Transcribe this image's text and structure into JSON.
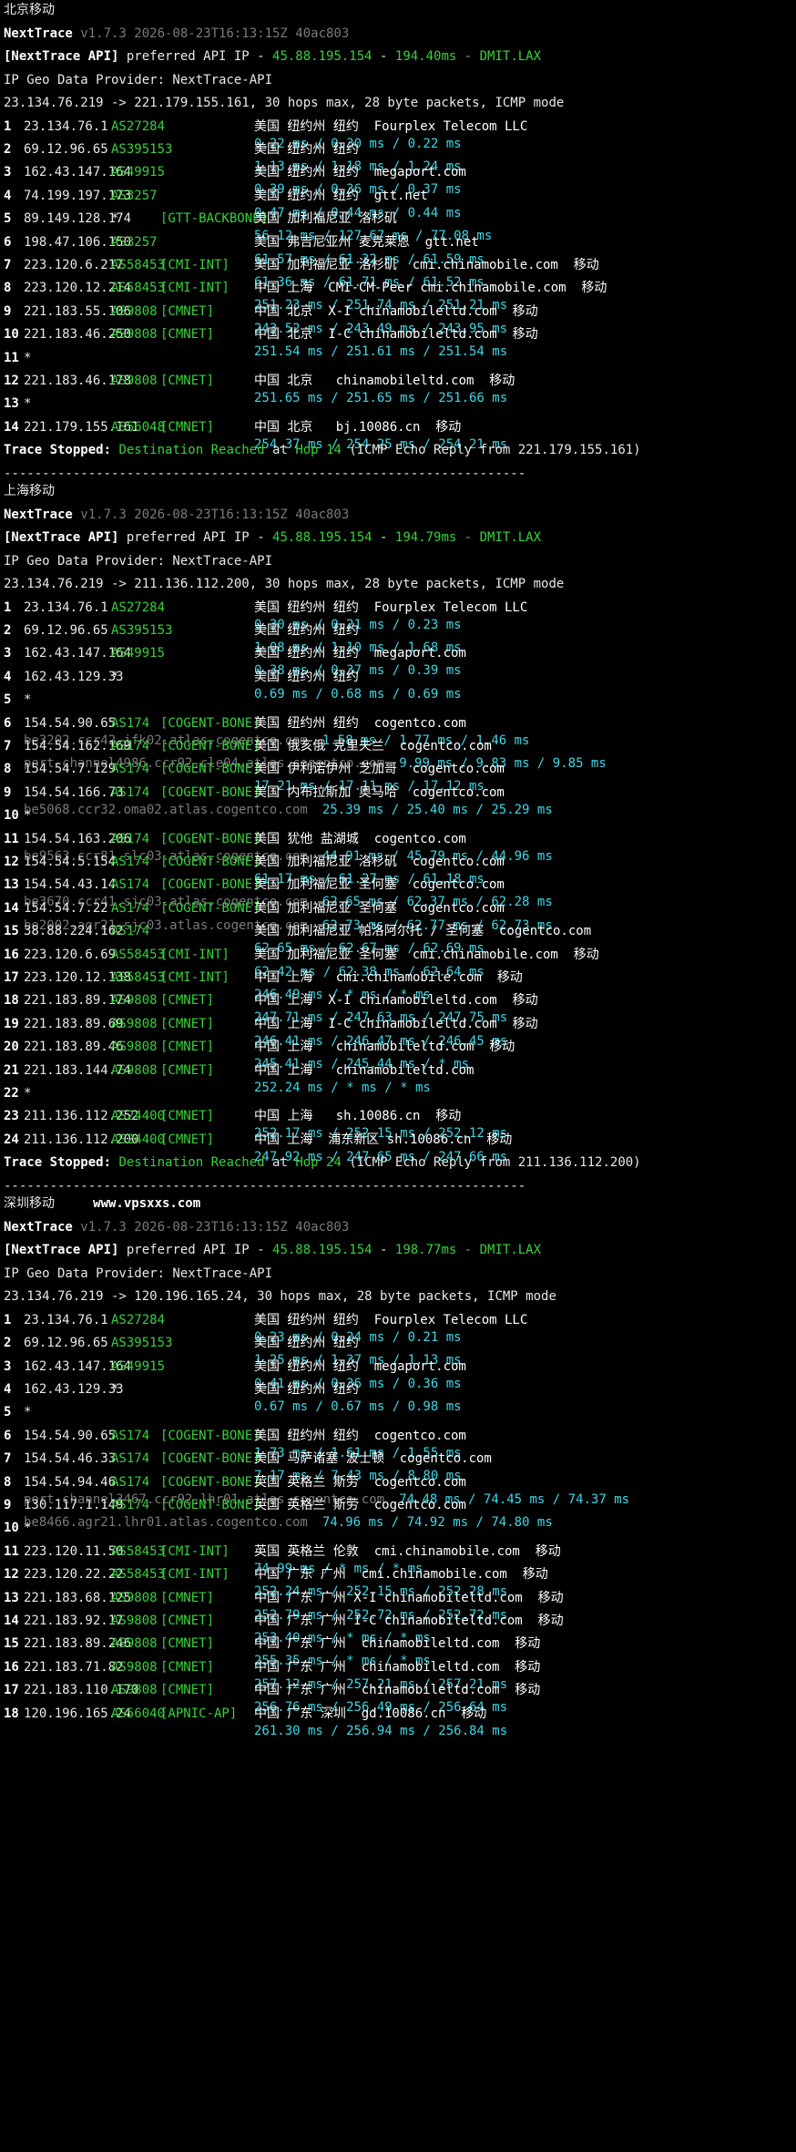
{
  "colors": {
    "text": "#e8e8e8",
    "dim": "#7a7a7a",
    "green": "#38d13a",
    "yellow": "#e5d43a",
    "cyan": "#3fd7e6",
    "bg": "#000000"
  },
  "sections": [
    {
      "title": "北京移动",
      "title_extra": "",
      "tool": "NextTrace",
      "version": "v1.7.3 2026-08-23T16:13:15Z 40ac803",
      "api_prefix": "[NextTrace API]",
      "api_mid": " preferred API IP - ",
      "api_ip": "45.88.195.154",
      "api_sep": " - ",
      "api_latency": "194.40ms",
      "api_site": " - DMIT.LAX",
      "geo_provider": "IP Geo Data Provider: NextTrace-API",
      "trace_info": "23.134.76.219 -> 221.179.155.161, 30 hops max, 28 byte packets, ICMP mode",
      "hops": [
        {
          "n": "1",
          "ip": "23.134.76.1",
          "asn": "AS27284",
          "tag": "",
          "geo": "美国 纽约州 纽约  Fourplex Telecom LLC",
          "rdns": "",
          "rtt": "0.22 ms / 0.30 ms / 0.22 ms"
        },
        {
          "n": "2",
          "ip": "69.12.96.65",
          "asn": "AS395153",
          "tag": "",
          "geo": "美国 纽约州 纽约",
          "rdns": "",
          "rtt": "1.13 ms / 1.18 ms / 1.24 ms"
        },
        {
          "n": "3",
          "ip": "162.43.147.164",
          "asn": "AS49915",
          "tag": "",
          "geo": "美国 纽约州 纽约  megaport.com",
          "rdns": "",
          "rtt": "0.39 ms / 0.36 ms / 0.37 ms"
        },
        {
          "n": "4",
          "ip": "74.199.197.173",
          "asn": "AS3257",
          "tag": "",
          "geo": "美国 纽约州 纽约  gtt.net",
          "rdns": "",
          "rtt": "0.47 ms / 0.44 ms / 0.44 ms"
        },
        {
          "n": "5",
          "ip": "89.149.128.174",
          "asn": "*",
          "tag": "[GTT-BACKBONE]",
          "geo": "美国 加利福尼亚 洛杉矶",
          "rdns": "",
          "rtt": "56.12 ms / 127.67 ms / 77.08 ms"
        },
        {
          "n": "6",
          "ip": "198.47.106.150",
          "asn": "AS3257",
          "tag": "",
          "geo": "美国 弗吉尼亚州 麦克莱恩  gtt.net",
          "rdns": "",
          "rtt": "61.57 ms / 61.32 ms / 61.59 ms"
        },
        {
          "n": "7",
          "ip": "223.120.6.217",
          "asn": "AS58453",
          "tag": "[CMI-INT]",
          "geo": "美国 加利福尼亚 洛杉矶  cmi.chinamobile.com  移动",
          "rdns": "",
          "rtt": "61.36 ms / 61.71 ms / 61.52 ms"
        },
        {
          "n": "8",
          "ip": "223.120.12.214",
          "asn": "AS58453",
          "tag": "[CMI-INT]",
          "geo": "中国 上海  CMI-CM-Peer cmi.chinamobile.com  移动",
          "rdns": "",
          "rtt": "251.23 ms / 251.74 ms / 251.21 ms"
        },
        {
          "n": "9",
          "ip": "221.183.55.106",
          "asn": "AS9808",
          "tag": "[CMNET]",
          "geo": "中国 北京  X-I chinamobileltd.com  移动",
          "rdns": "",
          "rtt": "243.52 ms / 243.49 ms / 243.95 ms"
        },
        {
          "n": "10",
          "ip": "221.183.46.250",
          "asn": "AS9808",
          "tag": "[CMNET]",
          "geo": "中国 北京  I-C chinamobileltd.com  移动",
          "rdns": "",
          "rtt": "251.54 ms / 251.61 ms / 251.54 ms"
        },
        {
          "n": "11",
          "ip": "*",
          "asn": "",
          "tag": "",
          "geo": "",
          "rdns": "",
          "rtt": ""
        },
        {
          "n": "12",
          "ip": "221.183.46.178",
          "asn": "AS9808",
          "tag": "[CMNET]",
          "geo": "中国 北京   chinamobileltd.com  移动",
          "rdns": "",
          "rtt": "251.65 ms / 251.65 ms / 251.66 ms"
        },
        {
          "n": "13",
          "ip": "*",
          "asn": "",
          "tag": "",
          "geo": "",
          "rdns": "",
          "rtt": ""
        },
        {
          "n": "14",
          "ip": "221.179.155.161",
          "asn": "AS56048",
          "tag": "[CMNET]",
          "geo": "中国 北京   bj.10086.cn  移动",
          "rdns": "",
          "rtt": "254.37 ms / 254.25 ms / 254.21 ms"
        }
      ],
      "stop_prefix": "Trace Stopped: ",
      "stop_reached": "Destination Reached",
      "stop_at": " at ",
      "stop_hop": "Hop 14",
      "stop_suffix": " (ICMP Echo Reply from 221.179.155.161)",
      "separator": "--------------------------------------------------------------------"
    },
    {
      "title": "上海移动",
      "title_extra": "",
      "tool": "NextTrace",
      "version": "v1.7.3 2026-08-23T16:13:15Z 40ac803",
      "api_prefix": "[NextTrace API]",
      "api_mid": " preferred API IP - ",
      "api_ip": "45.88.195.154",
      "api_sep": " - ",
      "api_latency": "194.79ms",
      "api_site": " - DMIT.LAX",
      "geo_provider": "IP Geo Data Provider: NextTrace-API",
      "trace_info": "23.134.76.219 -> 211.136.112.200, 30 hops max, 28 byte packets, ICMP mode",
      "hops": [
        {
          "n": "1",
          "ip": "23.134.76.1",
          "asn": "AS27284",
          "tag": "",
          "geo": "美国 纽约州 纽约  Fourplex Telecom LLC",
          "rdns": "",
          "rtt": "0.30 ms / 0.21 ms / 0.23 ms"
        },
        {
          "n": "2",
          "ip": "69.12.96.65",
          "asn": "AS395153",
          "tag": "",
          "geo": "美国 纽约州 纽约",
          "rdns": "",
          "rtt": "1.08 ms / 1.10 ms / 1.68 ms"
        },
        {
          "n": "3",
          "ip": "162.43.147.164",
          "asn": "AS49915",
          "tag": "",
          "geo": "美国 纽约州 纽约  megaport.com",
          "rdns": "",
          "rtt": "0.38 ms / 0.37 ms / 0.39 ms"
        },
        {
          "n": "4",
          "ip": "162.43.129.33",
          "asn": "*",
          "tag": "",
          "geo": "美国 纽约州 纽约",
          "rdns": "",
          "rtt": "0.69 ms / 0.68 ms / 0.69 ms"
        },
        {
          "n": "5",
          "ip": "*",
          "asn": "",
          "tag": "",
          "geo": "",
          "rdns": "",
          "rtt": ""
        },
        {
          "n": "6",
          "ip": "154.54.90.65",
          "asn": "AS174",
          "tag": "[COGENT-BONE]",
          "geo": "美国 纽约州 纽约  cogentco.com",
          "rdns": "be3202.ccr42.jfk02.atlas.cogentco.com",
          "rtt": "1.58 ms / 1.77 ms / 1.46 ms"
        },
        {
          "n": "7",
          "ip": "154.54.162.169",
          "asn": "AS174",
          "tag": "[COGENT-BONE]",
          "geo": "美国 俄亥俄 克里夫兰  cogentco.com",
          "rdns": "port-channel4986.ccr92.cle04.atlas.cogentco.com",
          "rtt": "9.99 ms / 9.83 ms / 9.85 ms"
        },
        {
          "n": "8",
          "ip": "154.54.7.129",
          "asn": "AS174",
          "tag": "[COGENT-BONE]",
          "geo": "美国 伊利诺伊州 芝加哥  cogentco.com",
          "rdns": "",
          "rtt": "17.21 ms / 17.11 ms / 17.12 ms"
        },
        {
          "n": "9",
          "ip": "154.54.166.73",
          "asn": "AS174",
          "tag": "[COGENT-BONE]",
          "geo": "美国 内布拉斯加 奥马哈  cogentco.com",
          "rdns": "be5068.ccr32.oma02.atlas.cogentco.com",
          "rtt": "25.39 ms / 25.40 ms / 25.29 ms"
        },
        {
          "n": "10",
          "ip": "*",
          "asn": "",
          "tag": "",
          "geo": "",
          "rdns": "",
          "rtt": ""
        },
        {
          "n": "11",
          "ip": "154.54.163.206",
          "asn": "AS174",
          "tag": "[COGENT-BONE]",
          "geo": "美国 犹他 盐湖城  cogentco.com",
          "rdns": "be9563.ccr81.slc03.atlas.cogentco.com",
          "rtt": "44.91 ms / 45.79 ms / 44.96 ms"
        },
        {
          "n": "12",
          "ip": "154.54.5.154",
          "asn": "AS174",
          "tag": "[COGENT-BONE]",
          "geo": "美国 加利福尼亚 洛杉矶  cogentco.com",
          "rdns": "",
          "rtt": "61.17 ms / 61.27 ms / 61.18 ms"
        },
        {
          "n": "13",
          "ip": "154.54.43.14",
          "asn": "AS174",
          "tag": "[COGENT-BONE]",
          "geo": "美国 加利福尼亚 圣何塞  cogentco.com",
          "rdns": "be3670.ccr41.sjc03.atlas.cogentco.com",
          "rtt": "62.65 ms / 62.37 ms / 62.28 ms"
        },
        {
          "n": "14",
          "ip": "154.54.7.22",
          "asn": "AS174",
          "tag": "[COGENT-BONE]",
          "geo": "美国 加利福尼亚 圣何塞  cogentco.com",
          "rdns": "be2002.agr21.sjc03.atlas.cogentco.com",
          "rtt": "62.73 ms / 62.77 ms / 62.73 ms"
        },
        {
          "n": "15",
          "ip": "38.88.224.162",
          "asn": "AS174",
          "tag": "",
          "geo": "美国 加利福尼亚 帕洛阿尔托 / 圣何塞  cogentco.com",
          "rdns": "",
          "rtt": "62.65 ms / 62.67 ms / 62.69 ms"
        },
        {
          "n": "16",
          "ip": "223.120.6.69",
          "asn": "AS58453",
          "tag": "[CMI-INT]",
          "geo": "美国 加利福尼亚 圣何塞  cmi.chinamobile.com  移动",
          "rdns": "",
          "rtt": "62.42 ms / 62.38 ms / 62.64 ms"
        },
        {
          "n": "17",
          "ip": "223.120.12.138",
          "asn": "AS58453",
          "tag": "[CMI-INT]",
          "geo": "中国 上海   cmi.chinamobile.com  移动",
          "rdns": "",
          "rtt": "246.49 ms / * ms / * ms"
        },
        {
          "n": "18",
          "ip": "221.183.89.174",
          "asn": "AS9808",
          "tag": "[CMNET]",
          "geo": "中国 上海  X-I chinamobileltd.com  移动",
          "rdns": "",
          "rtt": "247.71 ms / 247.63 ms / 247.75 ms"
        },
        {
          "n": "19",
          "ip": "221.183.89.69",
          "asn": "AS9808",
          "tag": "[CMNET]",
          "geo": "中国 上海  I-C chinamobileltd.com  移动",
          "rdns": "",
          "rtt": "246.41 ms / 246.47 ms / 246.45 ms"
        },
        {
          "n": "20",
          "ip": "221.183.89.46",
          "asn": "AS9808",
          "tag": "[CMNET]",
          "geo": "中国 上海   chinamobileltd.com  移动",
          "rdns": "",
          "rtt": "245.41 ms / 245.44 ms / * ms"
        },
        {
          "n": "21",
          "ip": "221.183.144.74",
          "asn": "AS9808",
          "tag": "[CMNET]",
          "geo": "中国 上海   chinamobileltd.com",
          "rdns": "",
          "rtt": "252.24 ms / * ms / * ms"
        },
        {
          "n": "22",
          "ip": "*",
          "asn": "",
          "tag": "",
          "geo": "",
          "rdns": "",
          "rtt": ""
        },
        {
          "n": "23",
          "ip": "211.136.112.252",
          "asn": "AS24400",
          "tag": "[CMNET]",
          "geo": "中国 上海   sh.10086.cn  移动",
          "rdns": "",
          "rtt": "252.17 ms / 252.15 ms / 252.12 ms"
        },
        {
          "n": "24",
          "ip": "211.136.112.200",
          "asn": "AS24400",
          "tag": "[CMNET]",
          "geo": "中国 上海  浦东新区 sh.10086.cn  移动",
          "rdns": "",
          "rtt": "247.92 ms / 247.65 ms / 247.66 ms"
        }
      ],
      "stop_prefix": "Trace Stopped: ",
      "stop_reached": "Destination Reached",
      "stop_at": " at ",
      "stop_hop": "Hop 24",
      "stop_suffix": " (ICMP Echo Reply from 211.136.112.200)",
      "separator": "--------------------------------------------------------------------"
    },
    {
      "title": "深圳移动",
      "title_extra": "www.vpsxxs.com",
      "tool": "NextTrace",
      "version": "v1.7.3 2026-08-23T16:13:15Z 40ac803",
      "api_prefix": "[NextTrace API]",
      "api_mid": " preferred API IP - ",
      "api_ip": "45.88.195.154",
      "api_sep": " - ",
      "api_latency": "198.77ms",
      "api_site": " - DMIT.LAX",
      "geo_provider": "IP Geo Data Provider: NextTrace-API",
      "trace_info": "23.134.76.219 -> 120.196.165.24, 30 hops max, 28 byte packets, ICMP mode",
      "hops": [
        {
          "n": "1",
          "ip": "23.134.76.1",
          "asn": "AS27284",
          "tag": "",
          "geo": "美国 纽约州 纽约  Fourplex Telecom LLC",
          "rdns": "",
          "rtt": "0.23 ms / 0.24 ms / 0.21 ms"
        },
        {
          "n": "2",
          "ip": "69.12.96.65",
          "asn": "AS395153",
          "tag": "",
          "geo": "美国 纽约州 纽约",
          "rdns": "",
          "rtt": "1.25 ms / 1.37 ms / 1.13 ms"
        },
        {
          "n": "3",
          "ip": "162.43.147.164",
          "asn": "AS49915",
          "tag": "",
          "geo": "美国 纽约州 纽约  megaport.com",
          "rdns": "",
          "rtt": "0.41 ms / 0.36 ms / 0.36 ms"
        },
        {
          "n": "4",
          "ip": "162.43.129.33",
          "asn": "*",
          "tag": "",
          "geo": "美国 纽约州 纽约",
          "rdns": "",
          "rtt": "0.67 ms / 0.67 ms / 0.98 ms"
        },
        {
          "n": "5",
          "ip": "*",
          "asn": "",
          "tag": "",
          "geo": "",
          "rdns": "",
          "rtt": ""
        },
        {
          "n": "6",
          "ip": "154.54.90.65",
          "asn": "AS174",
          "tag": "[COGENT-BONE]",
          "geo": "美国 纽约州 纽约  cogentco.com",
          "rdns": "",
          "rtt": "1.73 ms / 1.61 ms / 1.55 ms"
        },
        {
          "n": "7",
          "ip": "154.54.46.33",
          "asn": "AS174",
          "tag": "[COGENT-BONE]",
          "geo": "美国 马萨诸塞 波士顿  cogentco.com",
          "rdns": "",
          "rtt": "7.17 ms / 7.43 ms / 8.80 ms"
        },
        {
          "n": "8",
          "ip": "154.54.94.46",
          "asn": "AS174",
          "tag": "[COGENT-BONE]",
          "geo": "英国 英格兰 斯劳  cogentco.com",
          "rdns": "port-channel3467.ccr92.lhr01.atlas.cogentco.com",
          "rtt": "74.48 ms / 74.45 ms / 74.37 ms"
        },
        {
          "n": "9",
          "ip": "130.117.1.149",
          "asn": "AS174",
          "tag": "[COGENT-BONE]",
          "geo": "英国 英格兰 斯劳  cogentco.com",
          "rdns": "be8466.agr21.lhr01.atlas.cogentco.com",
          "rtt": "74.96 ms / 74.92 ms / 74.80 ms"
        },
        {
          "n": "10",
          "ip": "*",
          "asn": "",
          "tag": "",
          "geo": "",
          "rdns": "",
          "rtt": ""
        },
        {
          "n": "11",
          "ip": "223.120.11.50",
          "asn": "AS58453",
          "tag": "[CMI-INT]",
          "geo": "英国 英格兰 伦敦  cmi.chinamobile.com  移动",
          "rdns": "",
          "rtt": "74.99 ms / * ms / * ms"
        },
        {
          "n": "12",
          "ip": "223.120.22.22",
          "asn": "AS58453",
          "tag": "[CMI-INT]",
          "geo": "中国 广东 广州  cmi.chinamobile.com  移动",
          "rdns": "",
          "rtt": "252.24 ms / 252.15 ms / 252.28 ms"
        },
        {
          "n": "13",
          "ip": "221.183.68.125",
          "asn": "AS9808",
          "tag": "[CMNET]",
          "geo": "中国 广东 广州 X-I chinamobileltd.com  移动",
          "rdns": "",
          "rtt": "252.79 ms / 252.72 ms / 252.72 ms"
        },
        {
          "n": "14",
          "ip": "221.183.92.17",
          "asn": "AS9808",
          "tag": "[CMNET]",
          "geo": "中国 广东 广州 I-C chinamobileltd.com  移动",
          "rdns": "",
          "rtt": "253.40 ms / * ms / * ms"
        },
        {
          "n": "15",
          "ip": "221.183.89.246",
          "asn": "AS9808",
          "tag": "[CMNET]",
          "geo": "中国 广东 广州  chinamobileltd.com  移动",
          "rdns": "",
          "rtt": "255.35 ms / * ms / * ms"
        },
        {
          "n": "16",
          "ip": "221.183.71.82",
          "asn": "AS9808",
          "tag": "[CMNET]",
          "geo": "中国 广东 广州  chinamobileltd.com  移动",
          "rdns": "",
          "rtt": "257.12 ms / 257.21 ms / 257.21 ms"
        },
        {
          "n": "17",
          "ip": "221.183.110.170",
          "asn": "AS9808",
          "tag": "[CMNET]",
          "geo": "中国 广东 广州  chinamobileltd.com  移动",
          "rdns": "",
          "rtt": "256.76 ms / 256.49 ms / 256.64 ms"
        },
        {
          "n": "18",
          "ip": "120.196.165.24",
          "asn": "AS56040",
          "tag": "[APNIC-AP]",
          "geo": "中国 广东 深圳  gd.10086.cn  移动",
          "rdns": "",
          "rtt": "261.30 ms / 256.94 ms / 256.84 ms"
        }
      ]
    }
  ]
}
